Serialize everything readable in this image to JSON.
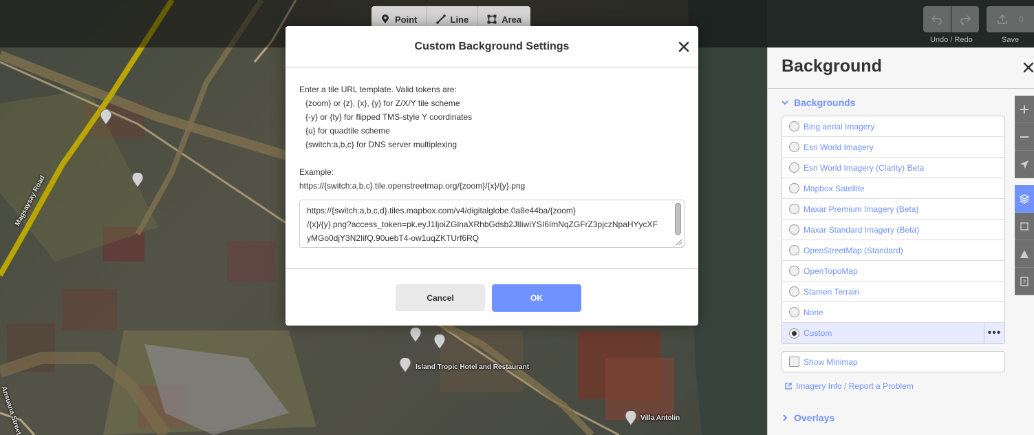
{
  "toolbar": {
    "modes": [
      {
        "label": "Point",
        "icon": "point-icon"
      },
      {
        "label": "Line",
        "icon": "line-icon"
      },
      {
        "label": "Area",
        "icon": "area-icon"
      }
    ],
    "undo_redo_caption": "Undo / Redo",
    "save_caption": "Save",
    "save_count": "0"
  },
  "map": {
    "labels": {
      "road": "Magsaysay Road",
      "hotel": "Island Tropic Hotel and Restaurant",
      "villa": "Villa Antolin",
      "street": "Ansuana Street"
    }
  },
  "modal": {
    "title": "Custom Background Settings",
    "intro": "Enter a tile URL template. Valid tokens are:",
    "tokens": [
      "{zoom} or {z}, {x}, {y} for Z/X/Y tile scheme",
      "{-y} or {ty} for flipped TMS-style Y coordinates",
      "{u} for quadtile scheme",
      "{switch:a,b,c} for DNS server multiplexing"
    ],
    "example_label": "Example:",
    "example_url": "https://{switch:a,b,c}.tile.openstreetmap.org/{zoom}/{x}/{y}.png",
    "url_lines": [
      "https://{switch:a,b,c,d}.tiles.mapbox.com/v4/digitalglobe.0a8e44ba/{zoom}",
      "/{x}/{y}.png?access_token=pk.eyJ1IjoiZGlnaXRhbGdsb2JlIiwiYSI6ImNqZGFrZ3pjczNpaHYycXF",
      "yMGo0djY3N2IifQ.90uebT4-ow1uqZKTUrf6RQ"
    ],
    "cancel": "Cancel",
    "ok": "OK"
  },
  "panel": {
    "title": "Background",
    "backgrounds_heading": "Backgrounds",
    "items": [
      {
        "label": "Bing aerial Imagery",
        "selected": false
      },
      {
        "label": "Esri World Imagery",
        "selected": false
      },
      {
        "label": "Esri World Imagery (Clarity) Beta",
        "selected": false
      },
      {
        "label": "Mapbox Satellite",
        "selected": false
      },
      {
        "label": "Maxar Premium Imagery (Beta)",
        "selected": false
      },
      {
        "label": "Maxar Standard Imagery (Beta)",
        "selected": false
      },
      {
        "label": "OpenStreetMap (Standard)",
        "selected": false
      },
      {
        "label": "OpenTopoMap",
        "selected": false
      },
      {
        "label": "Stamen Terrain",
        "selected": false
      },
      {
        "label": "None",
        "selected": false
      },
      {
        "label": "Custom",
        "selected": true
      }
    ],
    "minimap_label": "Show Minimap",
    "imagery_info": "Imagery Info / Report a Problem",
    "overlays_heading": "Overlays"
  },
  "colors": {
    "accent": "#7092ff",
    "text": "#333333"
  }
}
